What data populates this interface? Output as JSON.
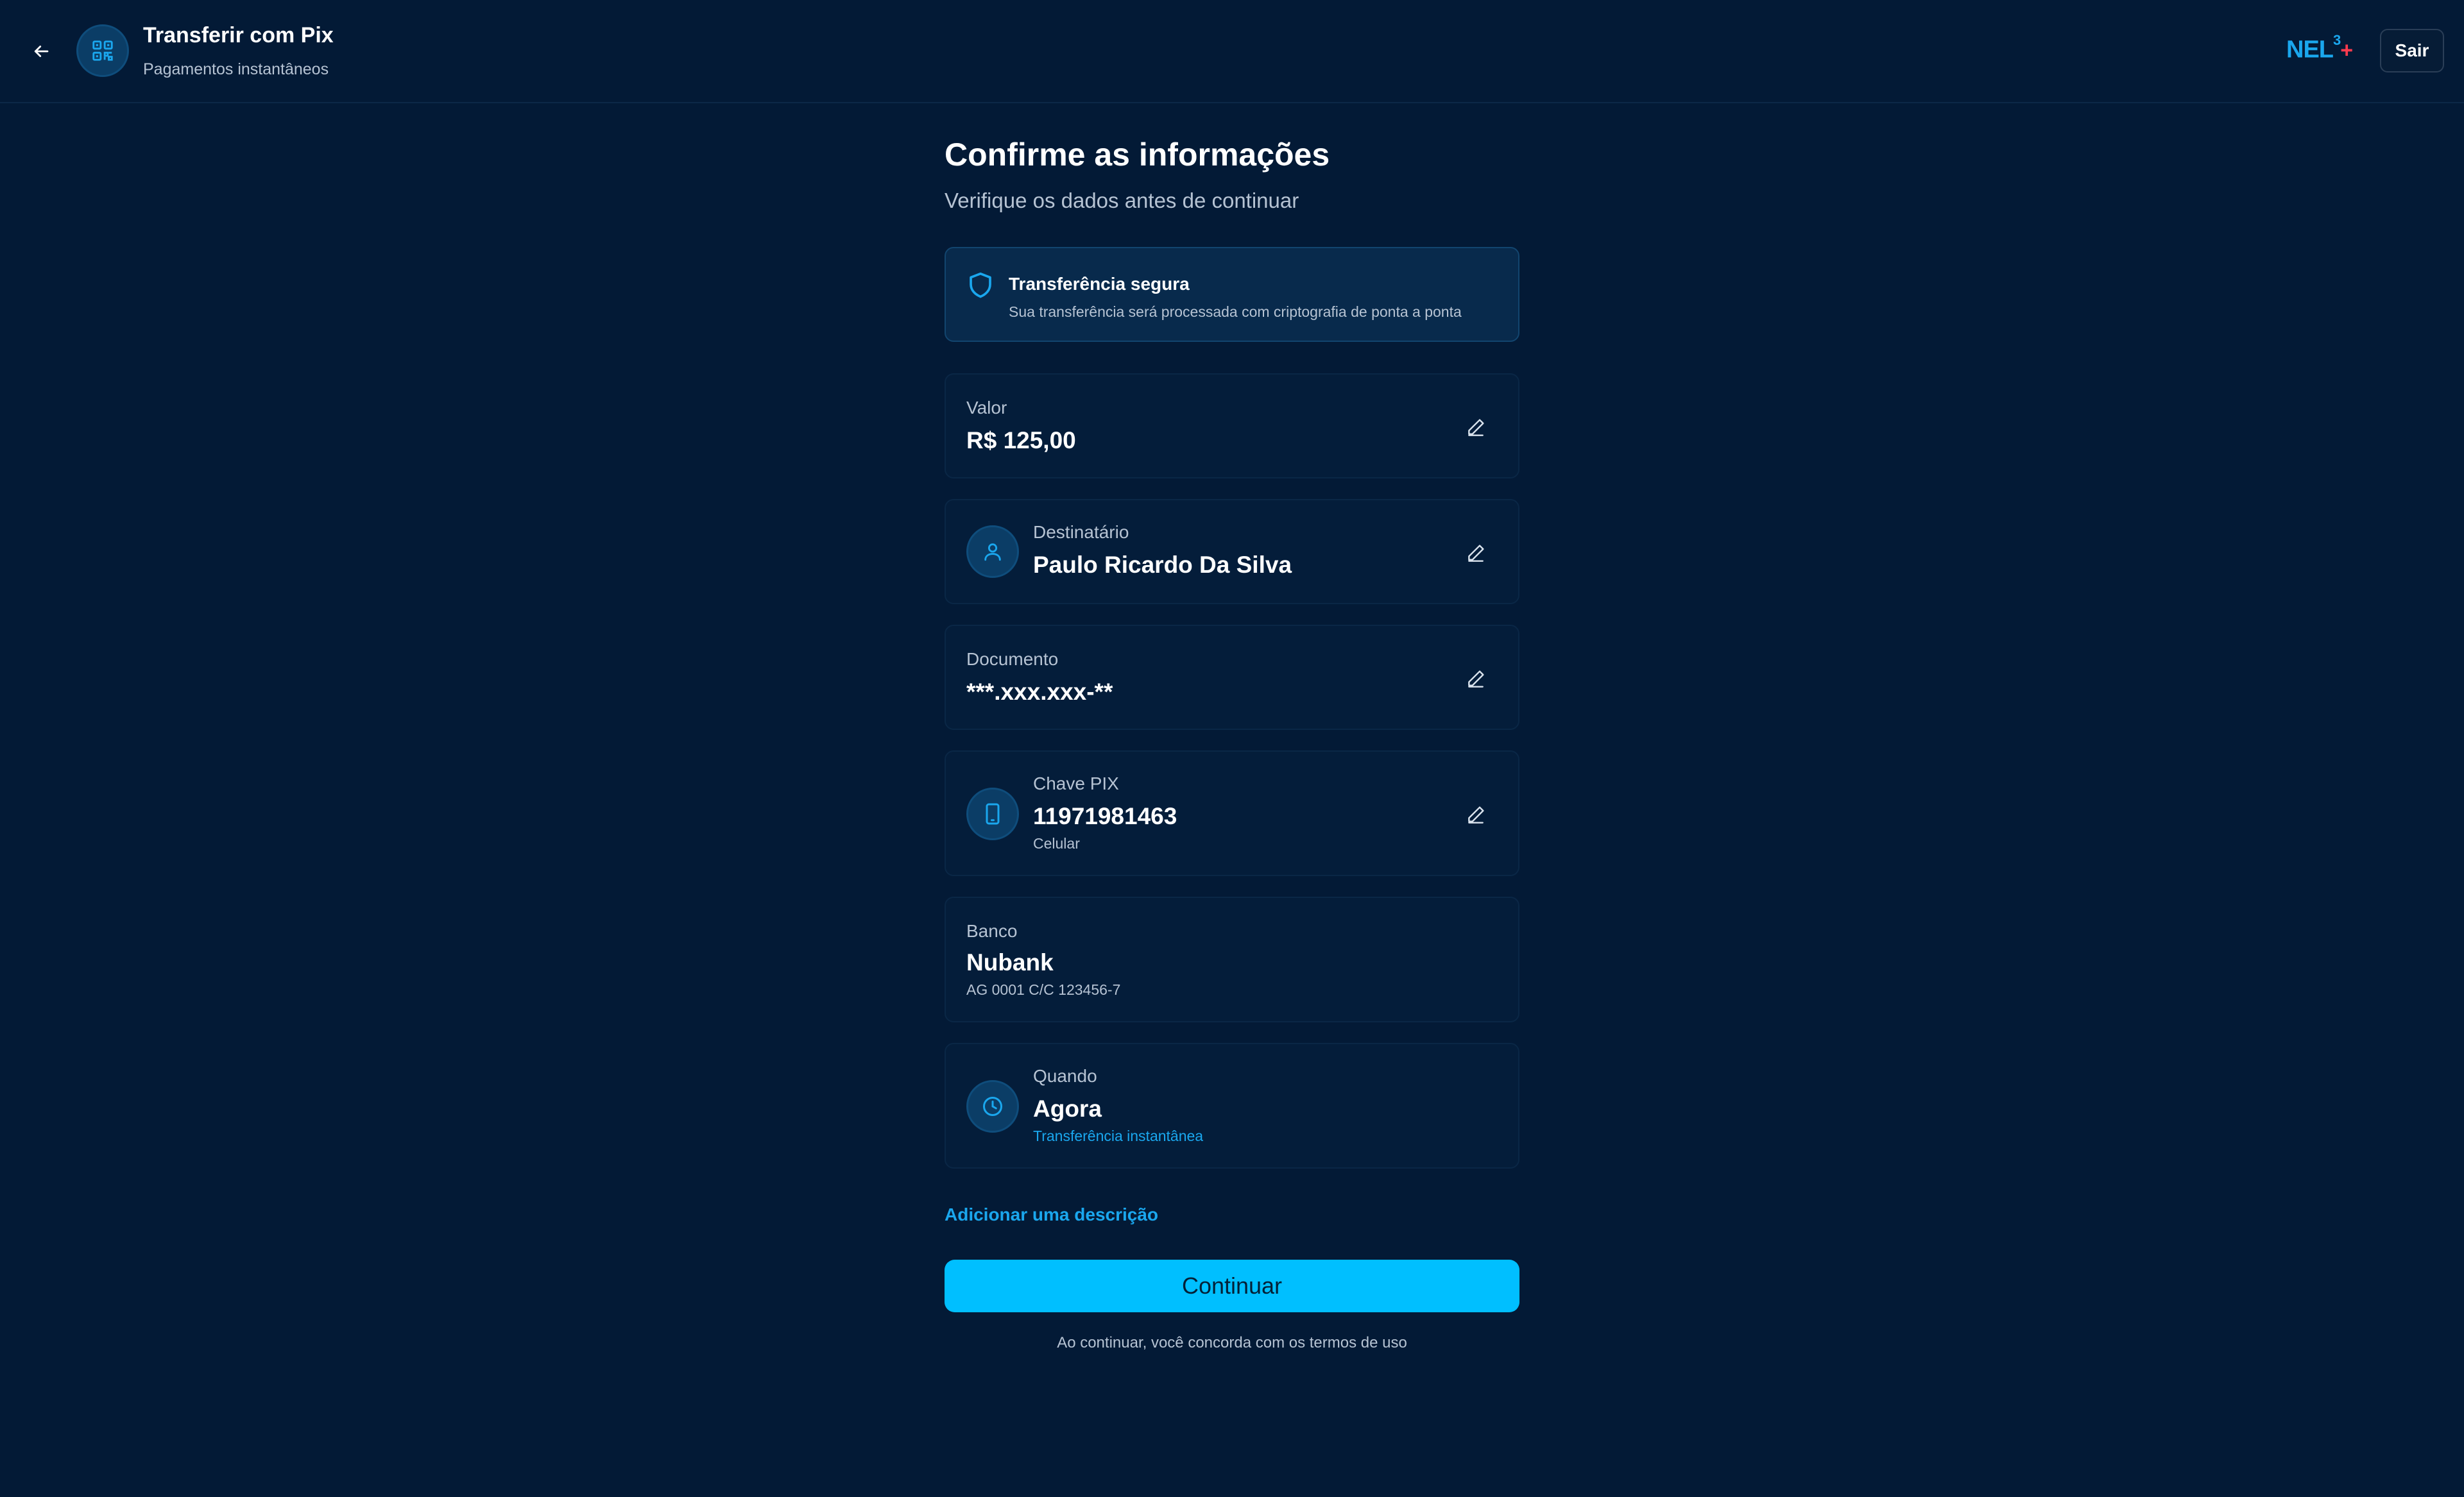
{
  "colors": {
    "background": "#031a36",
    "accent": "#00bfff",
    "link": "#1aa7ee",
    "brand_plus": "#ff3b4e",
    "card": "#041d3a",
    "secure_box": "#082a4c"
  },
  "header": {
    "back_icon": "arrow-left-icon",
    "app_icon": "qr-code-icon",
    "title": "Transferir com Pix",
    "subtitle": "Pagamentos instantâneos",
    "brand": {
      "name": "NEL",
      "superscript": "3",
      "plus": "+"
    },
    "logout_label": "Sair"
  },
  "main": {
    "title": "Confirme as informações",
    "subtitle": "Verifique os dados antes de continuar",
    "secure": {
      "icon": "shield-icon",
      "title": "Transferência segura",
      "text": "Sua transferência será processada com criptografia de ponta a ponta"
    },
    "valor": {
      "label": "Valor",
      "value": "R$ 125,00",
      "edit_icon": "pencil-icon"
    },
    "destinatario": {
      "icon": "user-icon",
      "label": "Destinatário",
      "value": "Paulo Ricardo Da Silva",
      "edit_icon": "pencil-icon"
    },
    "documento": {
      "label": "Documento",
      "value": "***.xxx.xxx-**",
      "edit_icon": "pencil-icon"
    },
    "chave_pix": {
      "icon": "smartphone-icon",
      "label": "Chave PIX",
      "value": "11971981463",
      "type": "Celular",
      "edit_icon": "pencil-icon"
    },
    "banco": {
      "label": "Banco",
      "value": "Nubank",
      "account": "AG 0001 C/C 123456-7"
    },
    "quando": {
      "icon": "clock-icon",
      "label": "Quando",
      "value": "Agora",
      "note": "Transferência instantânea"
    },
    "add_description": "Adicionar uma descrição",
    "continue_label": "Continuar",
    "terms": "Ao continuar, você concorda com os termos de uso"
  }
}
